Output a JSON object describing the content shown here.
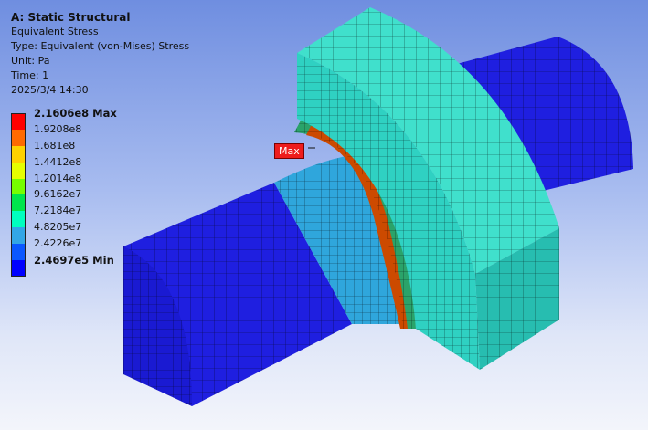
{
  "header": {
    "title": "A: Static Structural",
    "line1": "Equivalent Stress",
    "line2": "Type: Equivalent (von-Mises) Stress",
    "line3": "Unit: Pa",
    "line4": "Time: 1",
    "line5": "2025/3/4 14:30"
  },
  "legend": {
    "labels": [
      "2.1606e8 Max",
      "1.9208e8",
      "1.681e8",
      "1.4412e8",
      "1.2014e8",
      "9.6162e7",
      "7.2184e7",
      "4.8205e7",
      "2.4226e7",
      "2.4697e5 Min"
    ],
    "colors": [
      "#ff0000",
      "#ff6a00",
      "#ffd200",
      "#e6ff00",
      "#76ff00",
      "#00e64c",
      "#00ffbf",
      "#32a6e6",
      "#0a57ff",
      "#0000ff"
    ]
  },
  "probe": {
    "max_label": "Max"
  },
  "colors": {
    "shaft": "#1f1fe0",
    "shaft_side": "#1313b0",
    "shaft_top": "#2a2ae8",
    "collar_light": "#2fb7d9",
    "collar_dark": "#2a9ccc",
    "hub": "#35d6c4",
    "hub_side": "#27bdb0",
    "hub_top": "#40e0cc",
    "hot_band": "#cc4a00"
  }
}
